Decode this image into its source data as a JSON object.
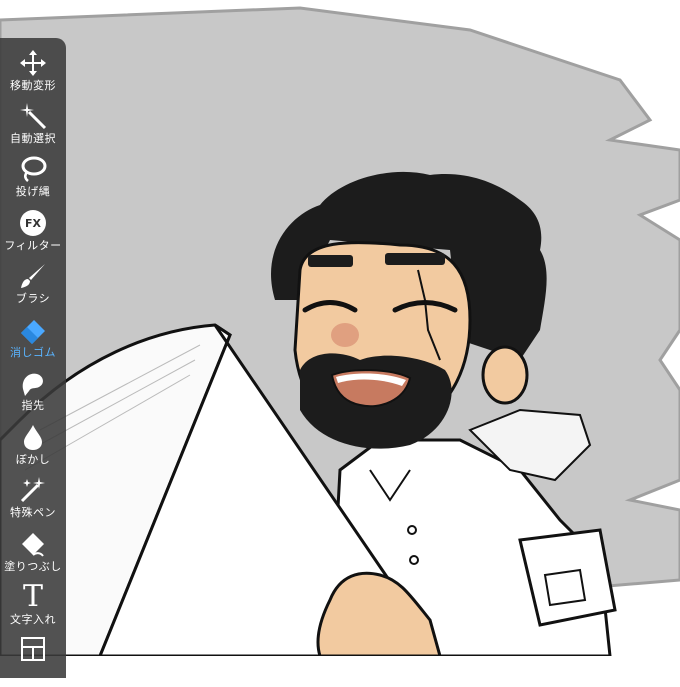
{
  "toolbar": {
    "tools": [
      {
        "label": "移動変形",
        "icon": "move-icon"
      },
      {
        "label": "自動選択",
        "icon": "magic-wand-icon"
      },
      {
        "label": "投げ縄",
        "icon": "lasso-icon"
      },
      {
        "label": "フィルター",
        "icon": "fx-icon",
        "glyph": "FX"
      },
      {
        "label": "ブラシ",
        "icon": "brush-icon"
      },
      {
        "label": "消しゴム",
        "icon": "eraser-icon",
        "active": true
      },
      {
        "label": "指先",
        "icon": "smudge-icon"
      },
      {
        "label": "ぼかし",
        "icon": "blur-icon"
      },
      {
        "label": "特殊ペン",
        "icon": "special-pen-icon"
      },
      {
        "label": "塗りつぶし",
        "icon": "fill-icon"
      },
      {
        "label": "文字入れ",
        "icon": "text-icon",
        "glyph": "T"
      }
    ]
  },
  "colors": {
    "toolbar_bg": "#3a3a3a",
    "active_label": "#5ab4ff",
    "canvas_gray": "#c8c8c8",
    "skin": "#f2caa0",
    "hair": "#1c1c1c"
  }
}
